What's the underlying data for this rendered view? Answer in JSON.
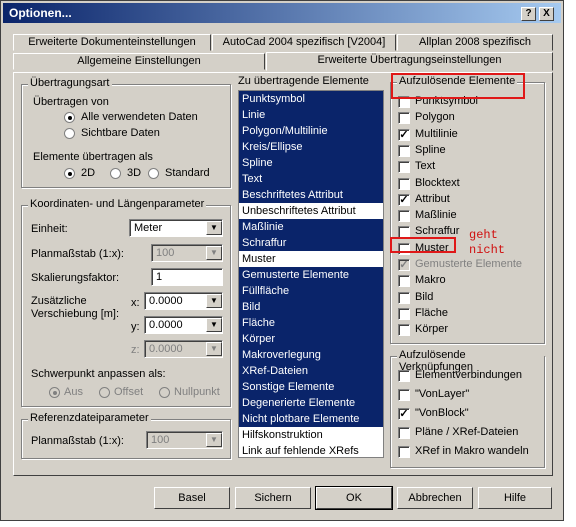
{
  "window": {
    "title": "Optionen...",
    "help_label": "?",
    "close_label": "X"
  },
  "tabs": [
    {
      "label": "Erweiterte Dokumenteinstellungen"
    },
    {
      "label": "AutoCad 2004 spezifisch [V2004]"
    },
    {
      "label": "Allplan 2008 spezifisch"
    },
    {
      "label": "Allgemeine Einstellungen"
    },
    {
      "label": "Erweiterte Übertragungseinstellungen"
    }
  ],
  "transfer": {
    "title": "Übertragungsart",
    "transfer_from_label": "Übertragen von",
    "options": [
      "Alle verwendeten Daten",
      "Sichtbare Daten"
    ],
    "elements_as_label": "Elemente übertragen als",
    "dims": [
      "2D",
      "3D",
      "Standard"
    ]
  },
  "coords": {
    "title": "Koordinaten- und Längenparameter",
    "unit_label": "Einheit:",
    "unit_value": "Meter",
    "scale_label": "Planmaßstab (1:x):",
    "scale_value": "100",
    "factor_label": "Skalierungsfaktor:",
    "factor_value": "1",
    "shift_label_1": "Zusätzliche",
    "shift_label_2": "Verschiebung [m]:",
    "x_label": "x:",
    "x_value": "0.0000",
    "y_label": "y:",
    "y_value": "0.0000",
    "z_label": "z:",
    "z_value": "0.0000",
    "center_label": "Schwerpunkt anpassen als:",
    "center_options": [
      "Aus",
      "Offset",
      "Nullpunkt"
    ]
  },
  "refparams": {
    "title": "Referenzdateiparameter",
    "scale_label": "Planmaßstab (1:x):",
    "scale_value": "100"
  },
  "elements_list": {
    "title": "Zu übertragende Elemente",
    "items": [
      {
        "label": "Punktsymbol",
        "selected": true
      },
      {
        "label": "Linie",
        "selected": true
      },
      {
        "label": "Polygon/Multilinie",
        "selected": true
      },
      {
        "label": "Kreis/Ellipse",
        "selected": true
      },
      {
        "label": "Spline",
        "selected": true
      },
      {
        "label": "Text",
        "selected": true
      },
      {
        "label": "Beschriftetes Attribut",
        "selected": true
      },
      {
        "label": "Unbeschriftetes Attribut",
        "selected": false
      },
      {
        "label": "Maßlinie",
        "selected": true
      },
      {
        "label": "Schraffur",
        "selected": true
      },
      {
        "label": "Muster",
        "selected": false
      },
      {
        "label": "Gemusterte Elemente",
        "selected": true
      },
      {
        "label": "Füllfläche",
        "selected": true
      },
      {
        "label": "Bild",
        "selected": true
      },
      {
        "label": "Fläche",
        "selected": true
      },
      {
        "label": "Körper",
        "selected": true
      },
      {
        "label": "Makroverlegung",
        "selected": true
      },
      {
        "label": "XRef-Dateien",
        "selected": true
      },
      {
        "label": "Sonstige Elemente",
        "selected": true
      },
      {
        "label": "Degenerierte Elemente",
        "selected": true
      },
      {
        "label": "Nicht plotbare Elemente",
        "selected": true
      },
      {
        "label": "Hilfskonstruktion",
        "selected": false
      },
      {
        "label": "Link auf fehlende XRefs",
        "selected": false
      }
    ]
  },
  "resolve": {
    "title": "Aufzulösende Elemente",
    "items": [
      {
        "label": "Punktsymbol",
        "checked": false,
        "disabled": false
      },
      {
        "label": "Polygon",
        "checked": false,
        "disabled": false
      },
      {
        "label": "Multilinie",
        "checked": true,
        "disabled": false
      },
      {
        "label": "Spline",
        "checked": false,
        "disabled": false
      },
      {
        "label": "Text",
        "checked": false,
        "disabled": false
      },
      {
        "label": "Blocktext",
        "checked": false,
        "disabled": false
      },
      {
        "label": "Attribut",
        "checked": true,
        "disabled": false
      },
      {
        "label": "Maßlinie",
        "checked": false,
        "disabled": false
      },
      {
        "label": "Schraffur",
        "checked": false,
        "disabled": false
      },
      {
        "label": "Muster",
        "checked": false,
        "disabled": false
      },
      {
        "label": "Gemusterte Elemente",
        "checked": true,
        "disabled": true
      },
      {
        "label": "Makro",
        "checked": false,
        "disabled": false
      },
      {
        "label": "Bild",
        "checked": false,
        "disabled": false
      },
      {
        "label": "Fläche",
        "checked": false,
        "disabled": false
      },
      {
        "label": "Körper",
        "checked": false,
        "disabled": false
      }
    ]
  },
  "links": {
    "title": "Aufzulösende Verknüpfungen",
    "items": [
      {
        "label": "Elementverbindungen",
        "checked": false
      },
      {
        "label": "\"VonLayer\"",
        "checked": false
      },
      {
        "label": "\"VonBlock\"",
        "checked": true
      },
      {
        "label": "Pläne / XRef-Dateien",
        "checked": false
      },
      {
        "label": "XRef in Makro wandeln",
        "checked": false
      }
    ]
  },
  "annotation": {
    "line1": "geht",
    "line2": "nicht",
    "color": "#d01010"
  },
  "buttons": {
    "reset": "Basel",
    "save": "Sichern",
    "ok": "OK",
    "cancel": "Abbrechen",
    "help": "Hilfe"
  },
  "colors": {
    "selection": "#0a246a",
    "face": "#d4d0c8"
  }
}
